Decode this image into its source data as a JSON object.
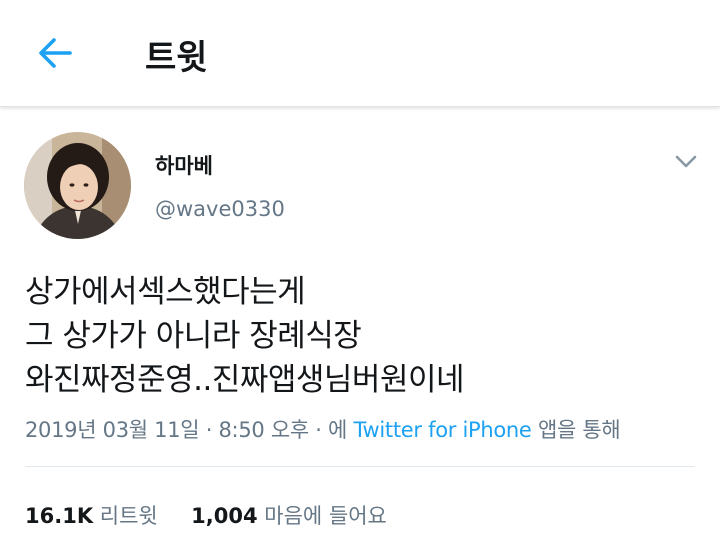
{
  "header": {
    "title": "트윗",
    "back_icon": "arrow-left-icon",
    "accent": "#1da1f2"
  },
  "tweet": {
    "display_name": "하마베",
    "handle": "@wave0330",
    "text_lines": [
      "상가에서섹스했다는게",
      "그 상가가 아니라 장례식장",
      "와진짜정준영..진짜앱생님버원이네"
    ],
    "date": "2019년 03월 11일",
    "sep1": "·",
    "time": "8:50 오후",
    "sep2": "·",
    "via_prefix": "에",
    "source": "Twitter for iPhone",
    "via_suffix": "앱을 통해"
  },
  "stats": {
    "retweets_count": "16.1K",
    "retweets_label": "리트윗",
    "likes_count": "1,004",
    "likes_label": "마음에 들어요"
  }
}
